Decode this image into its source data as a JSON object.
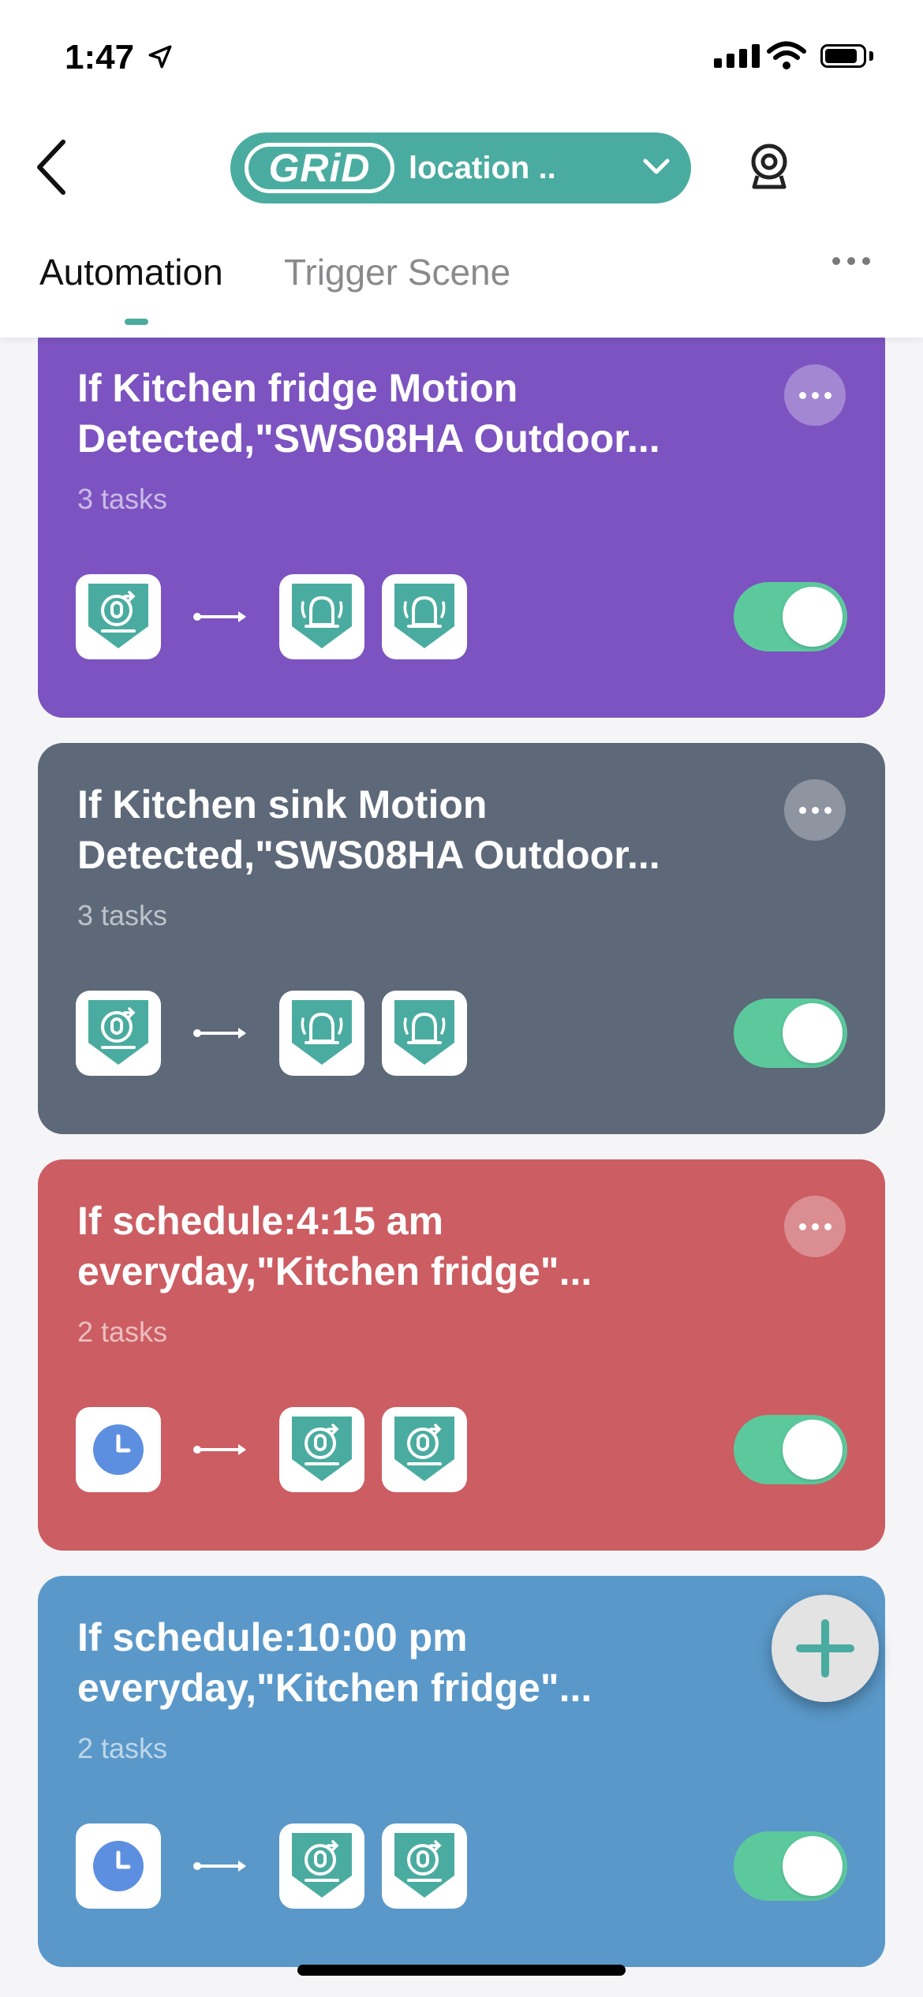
{
  "status_bar": {
    "time": "1:47"
  },
  "header": {
    "logo_text": "GRiD",
    "location_label": "location ..",
    "tabs": [
      {
        "label": "Automation",
        "active": true
      },
      {
        "label": "Trigger Scene",
        "active": false
      }
    ]
  },
  "colors": {
    "accent": "#4aaca0",
    "toggle_on": "#5cc99d",
    "card_purple": "#7c53c0",
    "card_slate": "#5d6879",
    "card_red": "#cc5d62",
    "card_blue": "#5a98c9"
  },
  "automations": [
    {
      "title_line1": "If Kitchen fridge Motion",
      "title_line2": "Detected,\"SWS08HA Outdoor...",
      "tasks": "3 tasks",
      "condition_icon": "motion-sensor-icon",
      "action_icons": [
        "alarm-bell-icon",
        "alarm-bell-icon"
      ],
      "enabled": true
    },
    {
      "title_line1": "If Kitchen sink Motion",
      "title_line2": "Detected,\"SWS08HA Outdoor...",
      "tasks": "3 tasks",
      "condition_icon": "motion-sensor-icon",
      "action_icons": [
        "alarm-bell-icon",
        "alarm-bell-icon"
      ],
      "enabled": true
    },
    {
      "title_line1": "If schedule:4:15 am",
      "title_line2": "everyday,\"Kitchen fridge\"...",
      "tasks": "2 tasks",
      "condition_icon": "clock-icon",
      "action_icons": [
        "motion-sensor-icon",
        "motion-sensor-icon"
      ],
      "enabled": true
    },
    {
      "title_line1": "If schedule:10:00 pm",
      "title_line2": "everyday,\"Kitchen fridge\"...",
      "tasks": "2 tasks",
      "condition_icon": "clock-icon",
      "action_icons": [
        "motion-sensor-icon",
        "motion-sensor-icon"
      ],
      "enabled": true
    }
  ]
}
